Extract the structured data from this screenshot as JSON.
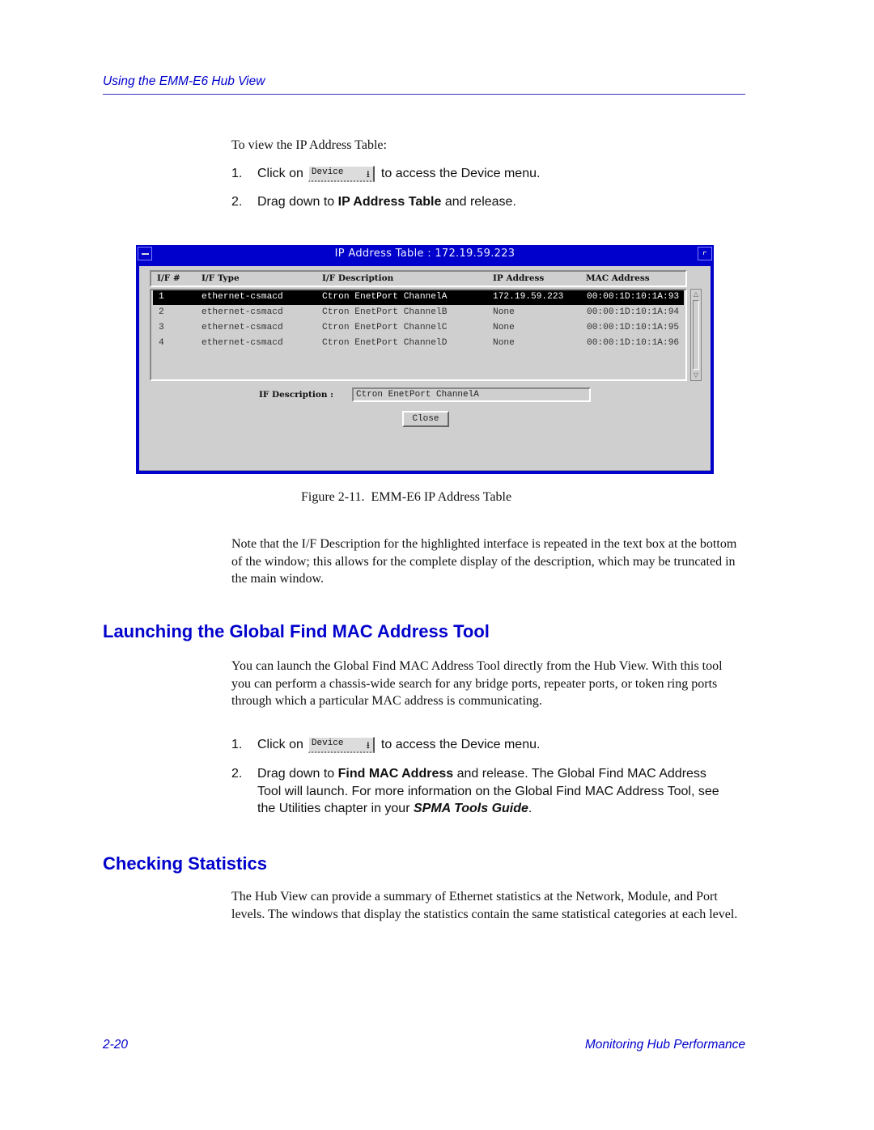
{
  "header": {
    "running_title": "Using the EMM-E6 Hub View"
  },
  "section1": {
    "intro": "To view the IP Address Table:",
    "steps": [
      {
        "num": "1.",
        "before": "Click on",
        "button_label": "Device",
        "after": "to access the Device menu."
      },
      {
        "num": "2.",
        "before": "Drag down to",
        "bold": "IP Address Table",
        "after": "and release."
      }
    ]
  },
  "window": {
    "title": "IP Address Table : 172.19.59.223",
    "columns": [
      "I/F #",
      "I/F Type",
      "I/F Description",
      "IP Address",
      "MAC Address"
    ],
    "rows": [
      {
        "if_num": "1",
        "if_type": "ethernet-csmacd",
        "description": "Ctron EnetPort ChannelA",
        "ip": "172.19.59.223",
        "mac": "00:00:1D:10:1A:93",
        "selected": true
      },
      {
        "if_num": "2",
        "if_type": "ethernet-csmacd",
        "description": "Ctron EnetPort ChannelB",
        "ip": "None",
        "mac": "00:00:1D:10:1A:94",
        "selected": false
      },
      {
        "if_num": "3",
        "if_type": "ethernet-csmacd",
        "description": "Ctron EnetPort ChannelC",
        "ip": "None",
        "mac": "00:00:1D:10:1A:95",
        "selected": false
      },
      {
        "if_num": "4",
        "if_type": "ethernet-csmacd",
        "description": "Ctron EnetPort ChannelD",
        "ip": "None",
        "mac": "00:00:1D:10:1A:96",
        "selected": false
      }
    ],
    "if_description_label": "IF Description :",
    "if_description_value": "Ctron EnetPort ChannelA",
    "close_label": "Close",
    "scroll_up_glyph": "△",
    "scroll_down_glyph": "▽"
  },
  "figure_caption": "Figure 2-11.  EMM-E6 IP Address Table",
  "note": "Note that the I/F Description for the highlighted interface is repeated in the text box at the bottom of the window; this allows for the complete display of the description, which may be truncated in the main window.",
  "section2": {
    "heading": "Launching the Global Find MAC Address Tool",
    "paragraph": "You can launch the Global Find MAC Address Tool directly from the Hub View. With this tool you can perform a chassis-wide search for any bridge ports, repeater ports, or token ring ports through which a particular MAC address is communicating.",
    "step1": {
      "num": "1.",
      "before": "Click on",
      "button_label": "Device",
      "after": "to access the Device menu."
    },
    "step2": {
      "num": "2.",
      "before": "Drag down to",
      "bold": "Find MAC Address",
      "middle": "and release. The Global Find MAC Address Tool will launch. For more information on the Global Find MAC Address Tool, see the Utilities chapter in your",
      "bold_italic": "SPMA Tools Guide",
      "end": "."
    }
  },
  "section3": {
    "heading": "Checking Statistics",
    "paragraph": "The Hub View can provide a summary of Ethernet statistics at the Network, Module, and Port levels. The windows that display the statistics contain the same statistical categories at each level."
  },
  "footer": {
    "page_number": "2-20",
    "chapter_title": "Monitoring Hub Performance"
  }
}
